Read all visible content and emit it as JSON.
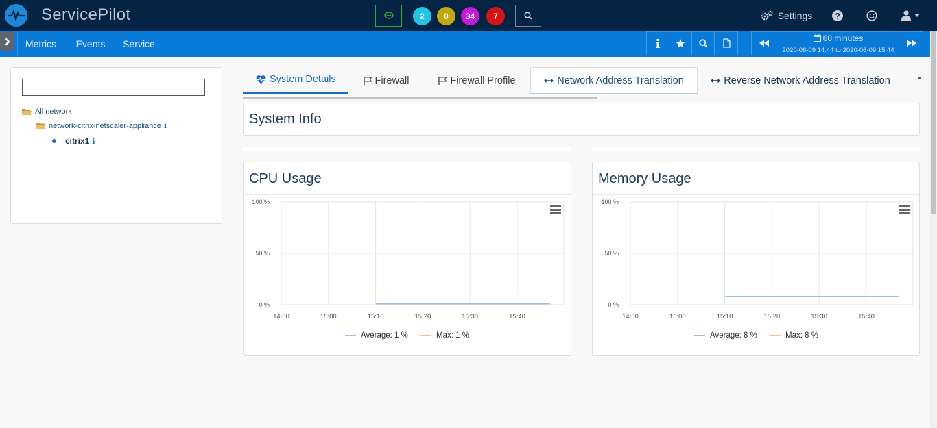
{
  "app": {
    "brand": "ServicePilot"
  },
  "topbar": {
    "badges": [
      {
        "value": "2",
        "color": "#21c6e6"
      },
      {
        "value": "0",
        "color": "#c2a812"
      },
      {
        "value": "34",
        "color": "#c21ad8"
      },
      {
        "value": "7",
        "color": "#d41515"
      }
    ],
    "settings_label": "Settings"
  },
  "navbar": {
    "items": [
      "Metrics",
      "Events",
      "Service"
    ],
    "time_label": "60 minutes",
    "time_range": "2020-06-09 14:44 to 2020-06-09 15:44"
  },
  "tree": {
    "search_value": "",
    "root": "All network",
    "group": "network-citrix-netscaler-appliance",
    "device": "citrix1"
  },
  "tabs": [
    {
      "label": "System Details"
    },
    {
      "label": "Firewall"
    },
    {
      "label": "Firewall Profile"
    },
    {
      "label": "Network Address Translation"
    },
    {
      "label": "Reverse Network Address Translation"
    }
  ],
  "system_info": {
    "title": "System Info"
  },
  "chart_data": [
    {
      "type": "line",
      "title": "CPU Usage",
      "x_ticks": [
        "14:50",
        "15:00",
        "15:10",
        "15:20",
        "15:30",
        "15:40"
      ],
      "y_ticks": [
        "0 %",
        "50 %",
        "100 %"
      ],
      "ylim": [
        0,
        100
      ],
      "series": [
        {
          "name": "Average: 1 %",
          "color": "#9ec0e8",
          "x": [
            "15:10",
            "15:47"
          ],
          "values": [
            1,
            1
          ]
        },
        {
          "name": "Max: 1 %",
          "color": "#f5c37a",
          "x": [
            "15:10",
            "15:47"
          ],
          "values": [
            1,
            1
          ]
        }
      ]
    },
    {
      "type": "line",
      "title": "Memory Usage",
      "x_ticks": [
        "14:50",
        "15:00",
        "15:10",
        "15:20",
        "15:30",
        "15:40"
      ],
      "y_ticks": [
        "0 %",
        "50 %",
        "100 %"
      ],
      "ylim": [
        0,
        100
      ],
      "series": [
        {
          "name": "Average: 8 %",
          "color": "#9ec0e8",
          "x": [
            "15:10",
            "15:47"
          ],
          "values": [
            8,
            8
          ]
        },
        {
          "name": "Max: 8 %",
          "color": "#f5c37a",
          "x": [
            "15:10",
            "15:47"
          ],
          "values": [
            8,
            8
          ]
        }
      ]
    }
  ]
}
